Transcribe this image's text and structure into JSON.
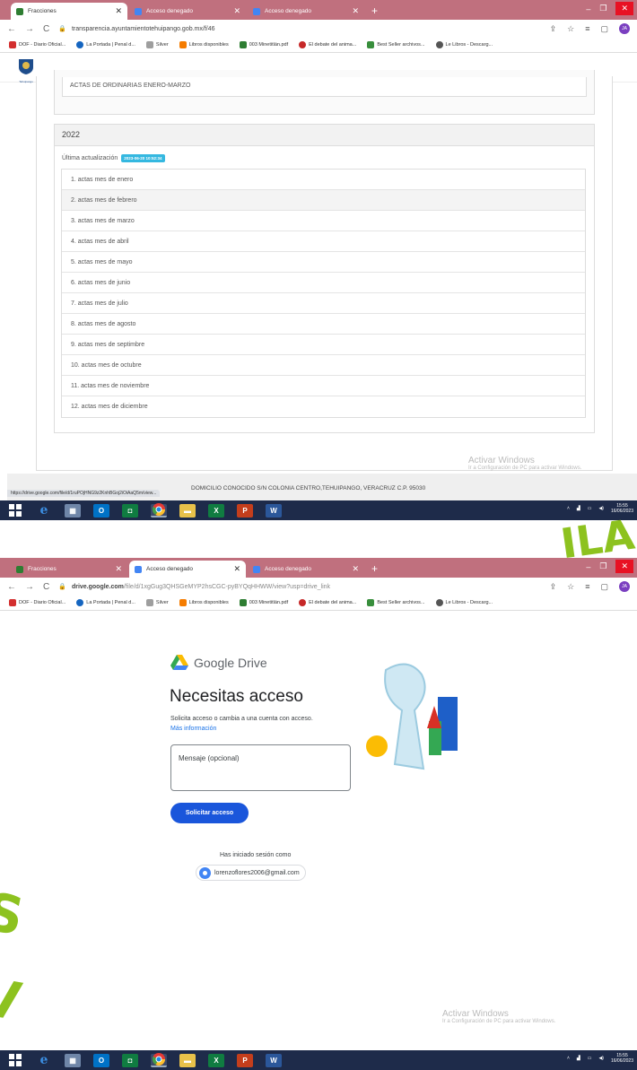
{
  "window": {
    "min": "–",
    "max": "❐",
    "close": "✕"
  },
  "browser1": {
    "tabs": [
      {
        "label": "Fracciones",
        "active": true,
        "favicon_color": "#2e7d32"
      },
      {
        "label": "Acceso denegado",
        "active": false,
        "favicon_color": "#4285f4"
      },
      {
        "label": "Acceso denegado",
        "active": false,
        "favicon_color": "#4285f4"
      }
    ],
    "url": "transparencia.ayuntamientotehuipango.gob.mx/f/46"
  },
  "browser2": {
    "tabs": [
      {
        "label": "Fracciones",
        "active": false,
        "favicon_color": "#2e7d32"
      },
      {
        "label": "Acceso denegado",
        "active": true,
        "favicon_color": "#4285f4"
      },
      {
        "label": "Acceso denegado",
        "active": false,
        "favicon_color": "#4285f4"
      }
    ],
    "url_host": "drive.google.com",
    "url_path": "/file/d/1xgGug3QHSGeMYP2hsCGC-pyBYQqHHWW/view?usp=drive_link"
  },
  "bookmarks": [
    {
      "label": "DOF - Diario Oficial...",
      "color": "#d32f2f"
    },
    {
      "label": "La Portada | Penal d...",
      "color": "#1565c0"
    },
    {
      "label": "Silver",
      "color": "#9e9e9e"
    },
    {
      "label": "Libros disponibles",
      "color": "#f57c00"
    },
    {
      "label": "003 Minetitlán.pdf",
      "color": "#2e7d32"
    },
    {
      "label": "El debate del anima...",
      "color": "#c62828"
    },
    {
      "label": "Best Seller archivos...",
      "color": "#388e3c"
    },
    {
      "label": "Le Libros - Descarg...",
      "color": "#555555"
    }
  ],
  "page1": {
    "logo_text": "Tehuipango",
    "prev_section_item": "ACTAS DE ORDINARIAS ENERO-MARZO",
    "year": "2022",
    "update_label": "Última actualización",
    "update_badge": "2023-06-20 10:52:34",
    "items": [
      "1. actas mes de enero",
      "2. actas mes de febrero",
      "3. actas mes de marzo",
      "4. actas mes de abril",
      "5. actas mes de mayo",
      "6. actas mes de junio",
      "7. actas mes de julio",
      "8. actas mes de agosto",
      "9. actas mes de septimbre",
      "10. actas mes de octubre",
      "11. actas mes de noviembre",
      "12. actas mes de diciembre"
    ],
    "footer": "DOMICILIO CONOCIDO S/N COLONIA CENTRO,TEHUIPANGO, VERACRUZ C.P. 95030",
    "status_url": "https://drive.google.com/file/d/1ruPOjHNG9z2KnhBGoj2iOiAaQ5m/view..."
  },
  "activate_windows": {
    "title": "Activar Windows",
    "subtitle": "Ir a Configuración de PC para activar Windows."
  },
  "clock": {
    "time": "15:55",
    "date": "16/06/2023"
  },
  "page2": {
    "brand": "Google Drive",
    "title": "Necesitas acceso",
    "desc": "Solicita acceso o cambia a una cuenta con acceso.",
    "more_link": "Más información",
    "message_placeholder": "Mensaje (opcional)",
    "request_button": "Solicitar acceso",
    "signed_in_label": "Has iniciado sesión como",
    "account": "lorenzoflores2006@gmail.com"
  },
  "overlay_letters": {
    "top": "ILA",
    "left_top": "S",
    "left_bottom": "V"
  },
  "colors": {
    "tab_strip": "#c0707e",
    "taskbar": "#1e2b4a",
    "overlay_green": "#8dc21f",
    "badge": "#35b8e0",
    "drive_button": "#1a56db"
  }
}
